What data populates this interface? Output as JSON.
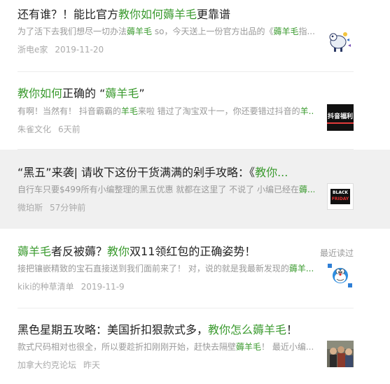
{
  "results": [
    {
      "title": [
        {
          "t": "还有谁？！能比官方",
          "hl": false
        },
        {
          "t": "教你如何薅羊毛",
          "hl": true
        },
        {
          "t": "更靠谱",
          "hl": false
        }
      ],
      "snippet": [
        {
          "t": "为了活下去我们想尽一切办法",
          "hl": false
        },
        {
          "t": "薅羊毛",
          "hl": true
        },
        {
          "t": " so，今天送上一份官方出品的《",
          "hl": false
        },
        {
          "t": "薅羊毛",
          "hl": true
        },
        {
          "t": "指...",
          "hl": false
        }
      ],
      "source": "浙电e家",
      "time": "2019-11-20",
      "thumb": "cartoon-sheep-thumbnail"
    },
    {
      "title": [
        {
          "t": "教你如何",
          "hl": true
        },
        {
          "t": "正确的 “",
          "hl": false
        },
        {
          "t": "薅羊毛",
          "hl": true
        },
        {
          "t": "”",
          "hl": false
        }
      ],
      "snippet": [
        {
          "t": "有啊！当然有！ 抖音霸霸的",
          "hl": false
        },
        {
          "t": "羊毛",
          "hl": true
        },
        {
          "t": "来啦 错过了淘宝双十一，你还要错过抖音的",
          "hl": false
        },
        {
          "t": "羊...",
          "hl": true
        }
      ],
      "source": "朱雀文化",
      "time": "6天前",
      "thumb": "douyin-welfare-thumbnail",
      "thumb_text": "抖音福利"
    },
    {
      "title": [
        {
          "t": "“黑五”来袭| 请收下这份干货满满的剁手攻略：《",
          "hl": false
        },
        {
          "t": "教你...",
          "hl": true
        }
      ],
      "snippet": [
        {
          "t": "自行车只要$499所有小编整理的黑五优惠 就都在这里了 不说了 小编已经在",
          "hl": false
        },
        {
          "t": "薅...",
          "hl": true
        }
      ],
      "source": "微珀斯",
      "time": "57分钟前",
      "thumb": "black-friday-thumbnail",
      "thumb_text": [
        "BLACK",
        "FRIDAY"
      ],
      "active": true
    },
    {
      "title": [
        {
          "t": "薅羊毛",
          "hl": true
        },
        {
          "t": "者反被薅？",
          "hl": false
        },
        {
          "t": "教你",
          "hl": true
        },
        {
          "t": "双11领红包的正确姿势！",
          "hl": false
        }
      ],
      "snippet": [
        {
          "t": "接把镶嵌精致的宝石直接送到我们面前来了！ 对，说的就是我最新发现的",
          "hl": false
        },
        {
          "t": "薅羊...",
          "hl": true
        }
      ],
      "source": "kiki的种草清单",
      "time": "2019-11-9",
      "thumb": "doraemon-thumbnail",
      "recent": "最近读过"
    },
    {
      "title": [
        {
          "t": "黑色星期五攻略：美国折扣狠款式多，",
          "hl": false
        },
        {
          "t": "教你怎么薅羊毛",
          "hl": true
        },
        {
          "t": "！",
          "hl": false
        }
      ],
      "snippet": [
        {
          "t": "款式尺码相对也很全，所以要趁折扣刚刚开始，赶快去隔壁",
          "hl": false
        },
        {
          "t": "薅羊毛",
          "hl": true
        },
        {
          "t": "！ 最近小编...",
          "hl": false
        }
      ],
      "source": "加拿大约克论坛",
      "time": "昨天",
      "thumb": "shopping-crowd-thumbnail"
    }
  ]
}
